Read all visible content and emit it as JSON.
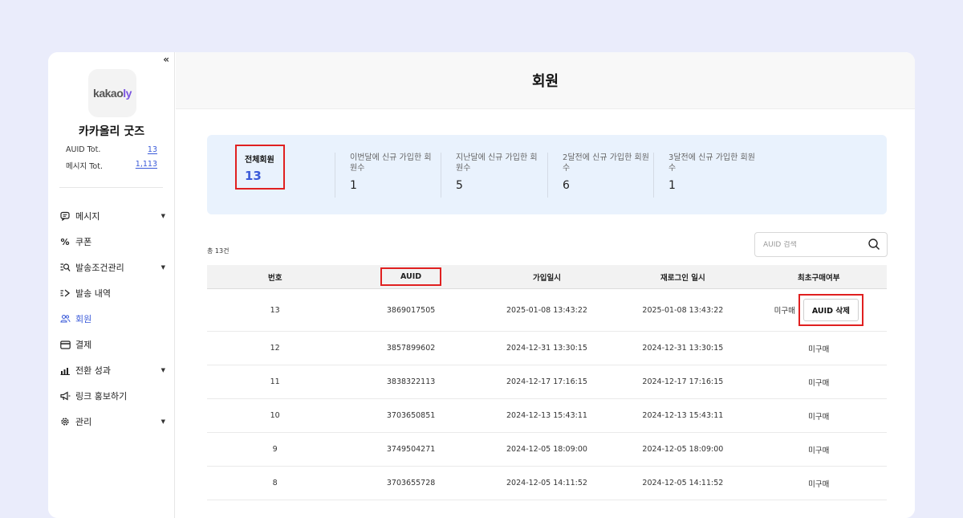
{
  "sidebar": {
    "collapse_label": "«",
    "logo_text_main": "kakao",
    "logo_text_accent": "ly",
    "brand_name": "카카올리 굿즈",
    "stats": [
      {
        "label": "AUID Tot.",
        "value": "13"
      },
      {
        "label": "메시지 Tot.",
        "value": "1,113"
      }
    ],
    "items": [
      {
        "label": "메시지",
        "icon": "message-icon",
        "has_caret": true
      },
      {
        "label": "쿠폰",
        "icon": "percent-icon",
        "has_caret": false
      },
      {
        "label": "발송조건관리",
        "icon": "filter-search-icon",
        "has_caret": true
      },
      {
        "label": "발송 내역",
        "icon": "send-history-icon",
        "has_caret": false
      },
      {
        "label": "회원",
        "icon": "users-icon",
        "has_caret": false,
        "active": true
      },
      {
        "label": "결제",
        "icon": "card-icon",
        "has_caret": false
      },
      {
        "label": "전환 성과",
        "icon": "chart-icon",
        "has_caret": true
      },
      {
        "label": "링크 홍보하기",
        "icon": "megaphone-icon",
        "has_caret": false
      },
      {
        "label": "관리",
        "icon": "gear-icon",
        "has_caret": true
      }
    ]
  },
  "header": {
    "title": "회원"
  },
  "summary": {
    "total_label": "전체회원",
    "total_value": "13",
    "columns": [
      {
        "label": "이번달에 신규 가입한 회원수",
        "value": "1"
      },
      {
        "label": "지난달에 신규 가입한 회원수",
        "value": "5"
      },
      {
        "label": "2달전에 신규 가입한 회원수",
        "value": "6"
      },
      {
        "label": "3달전에 신규 가입한 회원수",
        "value": "1"
      }
    ]
  },
  "list": {
    "count_text": "총 13건",
    "search_placeholder": "AUID 검색",
    "headers": [
      "번호",
      "AUID",
      "가입일시",
      "재로그인 일시",
      "최초구매여부"
    ],
    "delete_button_label": "AUID 삭제",
    "rows": [
      {
        "no": "13",
        "auid": "3869017505",
        "joined": "2025-01-08 13:43:22",
        "relogin": "2025-01-08 13:43:22",
        "purchase": "미구매"
      },
      {
        "no": "12",
        "auid": "3857899602",
        "joined": "2024-12-31 13:30:15",
        "relogin": "2024-12-31 13:30:15",
        "purchase": "미구매"
      },
      {
        "no": "11",
        "auid": "3838322113",
        "joined": "2024-12-17 17:16:15",
        "relogin": "2024-12-17 17:16:15",
        "purchase": "미구매"
      },
      {
        "no": "10",
        "auid": "3703650851",
        "joined": "2024-12-13 15:43:11",
        "relogin": "2024-12-13 15:43:11",
        "purchase": "미구매"
      },
      {
        "no": "9",
        "auid": "3749504271",
        "joined": "2024-12-05 18:09:00",
        "relogin": "2024-12-05 18:09:00",
        "purchase": "미구매"
      },
      {
        "no": "8",
        "auid": "3703655728",
        "joined": "2024-12-05 14:11:52",
        "relogin": "2024-12-05 14:11:52",
        "purchase": "미구매"
      }
    ]
  },
  "colors": {
    "accent": "#3b5bd9",
    "highlight": "#e02020",
    "summary_bg": "#e9f2fd",
    "page_bg": "#eaecfb"
  }
}
